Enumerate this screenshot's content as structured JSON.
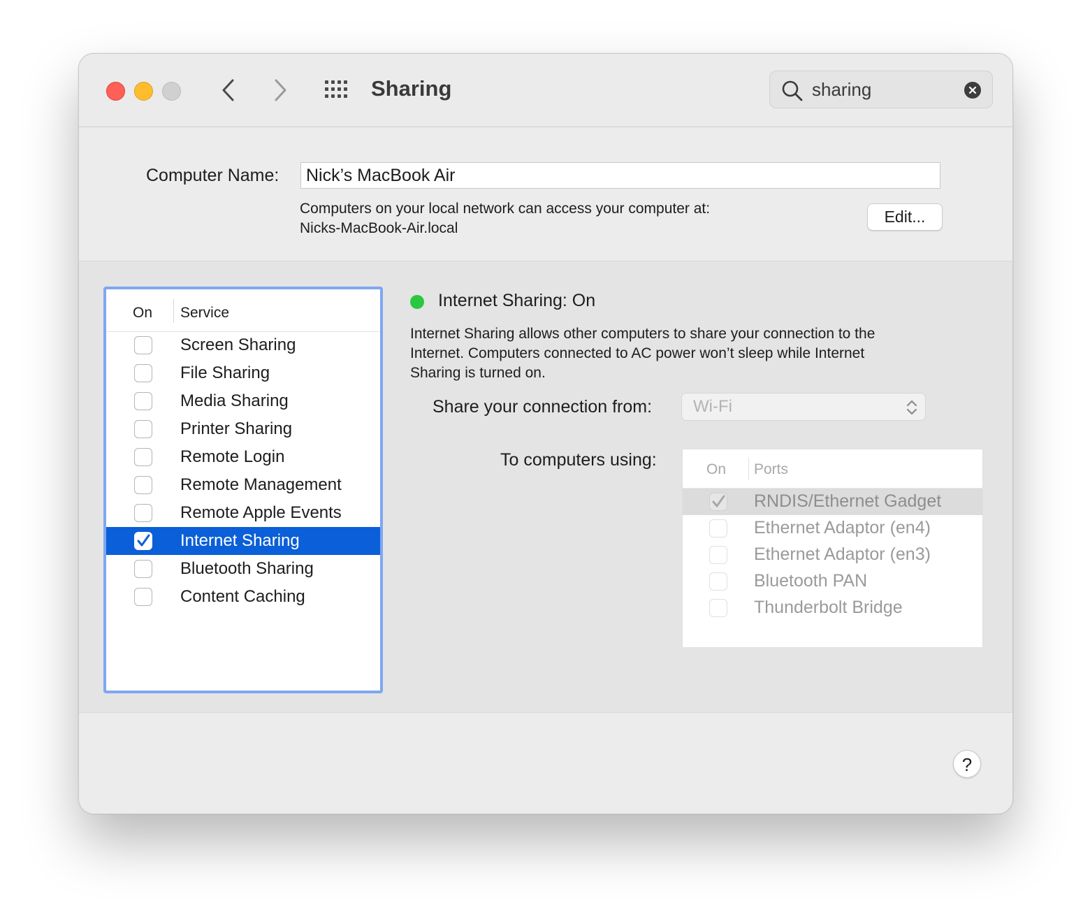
{
  "window": {
    "title": "Sharing"
  },
  "toolbar": {
    "search_value": "sharing"
  },
  "computer_name": {
    "label": "Computer Name:",
    "value": "Nick’s MacBook Air",
    "desc_line1": "Computers on your local network can access your computer at:",
    "desc_line2": "Nicks-MacBook-Air.local",
    "edit_label": "Edit..."
  },
  "services": {
    "col_on": "On",
    "col_service": "Service",
    "items": [
      {
        "label": "Screen Sharing",
        "checked": false,
        "selected": false
      },
      {
        "label": "File Sharing",
        "checked": false,
        "selected": false
      },
      {
        "label": "Media Sharing",
        "checked": false,
        "selected": false
      },
      {
        "label": "Printer Sharing",
        "checked": false,
        "selected": false
      },
      {
        "label": "Remote Login",
        "checked": false,
        "selected": false
      },
      {
        "label": "Remote Management",
        "checked": false,
        "selected": false
      },
      {
        "label": "Remote Apple Events",
        "checked": false,
        "selected": false
      },
      {
        "label": "Internet Sharing",
        "checked": true,
        "selected": true
      },
      {
        "label": "Bluetooth Sharing",
        "checked": false,
        "selected": false
      },
      {
        "label": "Content Caching",
        "checked": false,
        "selected": false
      }
    ]
  },
  "detail": {
    "status_title": "Internet Sharing: On",
    "status_color": "#2ac840",
    "desc_line1": "Internet Sharing allows other computers to share your connection to the",
    "desc_line2": "Internet. Computers connected to AC power won’t sleep while Internet",
    "desc_line3": "Sharing is turned on.",
    "share_from_label": "Share your connection from:",
    "share_from_value": "Wi-Fi",
    "to_label": "To computers using:",
    "ports_col_on": "On",
    "ports_col_ports": "Ports",
    "ports": [
      {
        "label": "RNDIS/Ethernet Gadget",
        "checked": true,
        "selected": true
      },
      {
        "label": "Ethernet Adaptor (en4)",
        "checked": false,
        "selected": false
      },
      {
        "label": "Ethernet Adaptor (en3)",
        "checked": false,
        "selected": false
      },
      {
        "label": "Bluetooth PAN",
        "checked": false,
        "selected": false
      },
      {
        "label": "Thunderbolt Bridge",
        "checked": false,
        "selected": false
      }
    ]
  },
  "help_label": "?",
  "colors": {
    "selection": "#0b5fd8",
    "list_focus_ring": "#7ea7f1",
    "close": "#fe5f57",
    "minimize": "#febc2e"
  },
  "icons": {
    "back": "chevron-left-icon",
    "forward": "chevron-right-icon",
    "show_all": "grid-icon",
    "search": "search-icon",
    "clear": "clear-icon",
    "popup": "up-down-chevron-icon",
    "check": "checkmark-icon"
  }
}
